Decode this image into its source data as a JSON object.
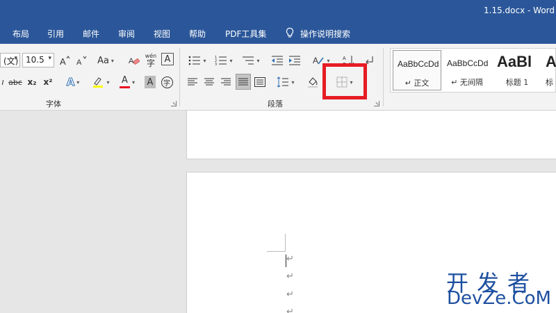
{
  "title_bar": {
    "document": "1.15.docx  -  Word"
  },
  "menu": {
    "tabs": [
      "布局",
      "引用",
      "邮件",
      "审阅",
      "视图",
      "帮助",
      "PDF工具集"
    ],
    "tell_me": "操作说明搜索"
  },
  "font_group": {
    "font_name": "(文)",
    "font_size": "10.5",
    "label": "字体",
    "change_case": "Aa",
    "phonetic_top": "wén",
    "phonetic_bottom": "字",
    "border_char": "A",
    "strike": "abc",
    "subscript": "x₂",
    "superscript": "x²",
    "effects": "A",
    "font_color": "A",
    "shade_char": "A",
    "enclose_char": "字",
    "highlight_color": "#ffff00",
    "font_color_bar": "#e81123"
  },
  "paragraph_group": {
    "label": "段落"
  },
  "styles": {
    "items": [
      {
        "preview": "AaBbCcDd",
        "name": "正文"
      },
      {
        "preview": "AaBbCcDd",
        "name": "无间隔"
      },
      {
        "preview": "AaBl",
        "name": "标题 1"
      },
      {
        "preview": "A",
        "name": "标"
      }
    ]
  },
  "document": {
    "paragraph_marks": [
      "↵",
      "↵",
      "↵",
      "↵"
    ]
  },
  "watermark": {
    "line1": "开发者",
    "line2": "DevZe.CoM"
  },
  "colors": {
    "accent": "#2b579a",
    "highlight_box": "#e61c24",
    "watermark": "#1d4fa0"
  }
}
